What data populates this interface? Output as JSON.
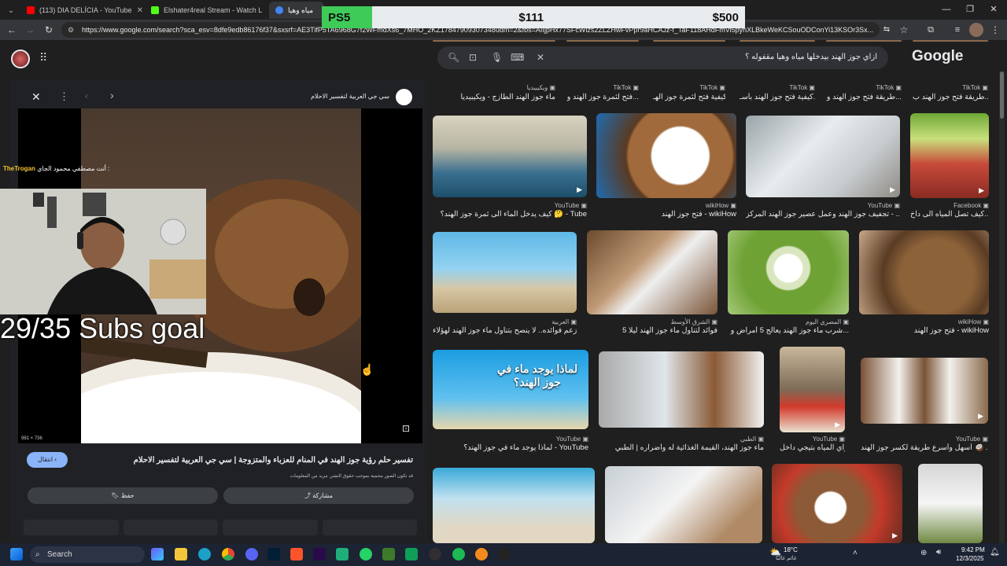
{
  "tabs": [
    {
      "title": "(113) DIA DELÍCIA - YouTube",
      "color": "#ff0000"
    },
    {
      "title": "Elshater4real Stream - Watch L",
      "color": "#53fc18"
    },
    {
      "title": "مياه وهيا",
      "color": "#4285f4"
    }
  ],
  "goal_overlay": {
    "label": "PS5",
    "current": "$111",
    "target": "$500",
    "progress": 0.222
  },
  "address_url": "https://www.google.com/search?sca_esv=8dfe9edb86176f37&sxsrf=AE3TifP5TA6968G7f2WFmdXs6_7MHO_2KZ17847909307348udm=2&fbs=AIIjpHx77SFcWlzs2ZLZHwFvPpr9aHCAJz-f_TaF118AHdFmVi5pyhXLBkeWeKCSouODConYi13KSOr3Sx...",
  "search": {
    "query": "ازاي جوز الهند بيدخلها مياه وهيا مقفوله ؟",
    "logo": "Google"
  },
  "viewer": {
    "source_name": "سي جي العربية لتفسير الاحلام",
    "dims": "981 × 736",
    "title": "تفسير حلم رؤية جوز الهند في المنام للعزباء والمتزوجة | سي جي العربية لتفسير الاحلام",
    "copyright": "قد تكون الصور محمية بموجب حقوق النشر. مزيد من المعلومات",
    "visit_label": "انتقال",
    "save_label": "حفظ",
    "share_label": "مشاركة"
  },
  "stream": {
    "goal_text": "29/35 Subs goal",
    "chat_user": "TheTrogan",
    "chat_msg": "أنت مصطفي محمود الجاي :"
  },
  "top_row": [
    {
      "source": "ويكيبيديا",
      "title": "ماء جوز الهند الطازج - ويكيبيديا"
    },
    {
      "source": "TikTok",
      "title": "فتح لثمرة جوز الهند و..."
    },
    {
      "source": "TikTok",
      "title": "كيفية فتح لثمرة جوز الهـ..."
    },
    {
      "source": "TikTok",
      "title": "كيفية فتح جوز الهند بأسـ..."
    },
    {
      "source": "TikTok",
      "title": "طريقة فتح جوز الهند و..."
    },
    {
      "source": "TikTok",
      "title": "طريقة فتح جوز الهند ب..."
    }
  ],
  "row1": [
    {
      "source": "YouTube",
      "title": "كيف يدخل الماء الى ثمرة جوز الهند؟ 🤔 - Tube"
    },
    {
      "source": "wikiHow",
      "title": "فتح جوز الهند - wikiHow"
    },
    {
      "source": "YouTube",
      "title": "تجفيف جوز الهند وعمل عصير جوز الهند المركز - ..."
    },
    {
      "source": "Facebook",
      "title": "كيف تصل المياه الى داخ..."
    }
  ],
  "row2": [
    {
      "source": "العربية",
      "title": "زعم فوائده.. لا ينصح بتناول ماء جوز الهند لهؤلاء"
    },
    {
      "source": "الشرق الأوسط",
      "title": "5 فوائد لتناول ماء جوز الهند ليلا"
    },
    {
      "source": "المصري اليوم",
      "title": "شرب ماء جوز الهند يعالج 5 أمراض و..."
    },
    {
      "source": "wikiHow",
      "title": "فتح جوز الهند - wikiHow"
    }
  ],
  "row3": [
    {
      "source": "YouTube",
      "title": "لماذا يوجد ماء في جوز الهند؟ - YouTube",
      "caption": "لماذا يوجد ماء في جوز الهند؟"
    },
    {
      "source": "الطبي",
      "title": "ماء جوز الهند، القيمة الغذائية له وأضراره | الطبي"
    },
    {
      "source": "YouTube",
      "title": "ازاي المياه بتيجي داخل..."
    },
    {
      "source": "YouTube",
      "title": "أسهل وأسرع طريقة لكسر جوز الهند 🥥 ..."
    }
  ],
  "taskbar": {
    "search_label": "Search",
    "weather_temp": "18°C",
    "weather_desc": "غائم غالبًا",
    "time": "9:42 PM",
    "date": "12/3/2025"
  }
}
